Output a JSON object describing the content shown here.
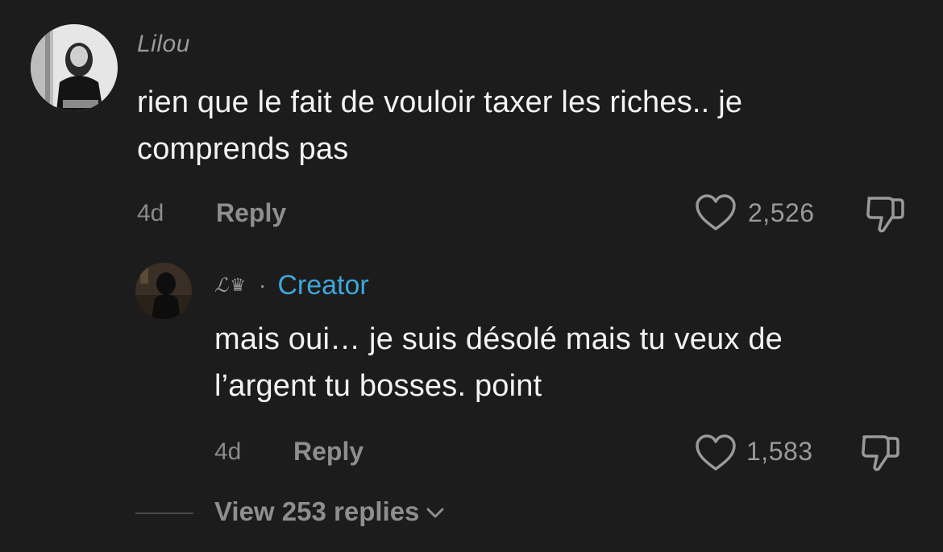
{
  "comment": {
    "username": "Lilou",
    "text_line1": "rien que le fait de vouloir taxer les riches.. je",
    "text_line2": "comprends pas",
    "time": "4d",
    "reply_label": "Reply",
    "likes": "2,526"
  },
  "reply": {
    "username": "ℒ",
    "crown_glyph": "♛",
    "separator": "·",
    "creator_label": "Creator",
    "text_line1": "mais oui… je suis désolé mais tu veux de",
    "text_line2": "l’argent tu bosses. point",
    "time": "4d",
    "reply_label": "Reply",
    "likes": "1,583"
  },
  "view_replies_label": "View 253 replies",
  "colors": {
    "background": "#1c1c1c",
    "creator_accent": "#3ea6d8",
    "muted_text": "#8e8e8e"
  }
}
